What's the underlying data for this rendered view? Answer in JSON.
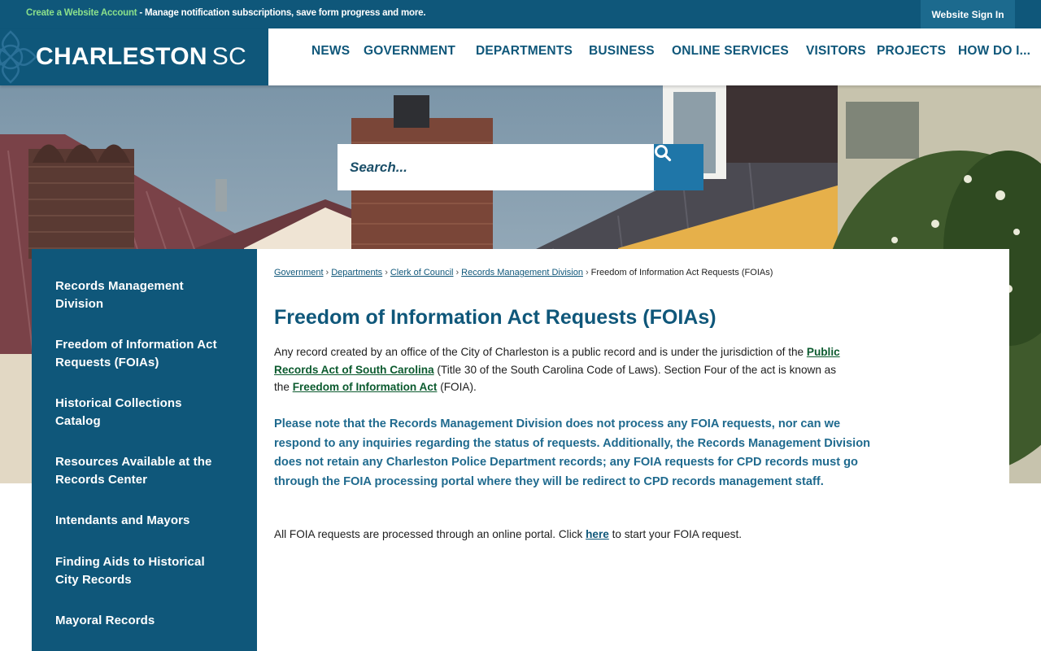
{
  "topbar": {
    "create_account_link": "Create a Website Account",
    "message": " - Manage notification subscriptions, save form progress and more.",
    "signin_label": "Website Sign In"
  },
  "logo": {
    "name": "CHARLESTON",
    "suffix": "SC"
  },
  "nav": {
    "items": [
      "NEWS",
      "GOVERNMENT",
      "DEPARTMENTS",
      "BUSINESS",
      "ONLINE SERVICES",
      "VISITORS",
      "PROJECTS",
      "HOW DO I..."
    ]
  },
  "search": {
    "placeholder": "Search...",
    "icon": "search-icon"
  },
  "sidebar": {
    "items": [
      "Records Management Division",
      "Freedom of Information Act Requests (FOIAs)",
      "Historical Collections Catalog",
      "Resources Available at the Records Center",
      "Intendants and Mayors",
      "Finding Aids to Historical City Records",
      "Mayoral Records"
    ]
  },
  "breadcrumb": {
    "items": [
      "Government",
      "Departments",
      "Clerk of Council",
      "Records Management Division"
    ],
    "separator": "›",
    "current": "Freedom of Information Act Requests (FOIAs)"
  },
  "page": {
    "title": "Freedom of Information Act Requests (FOIAs)",
    "intro_1": "Any record created by an office of the City of Charleston is a public record and is under the jurisdiction of the ",
    "intro_link_1": "Public Records Act of South Carolina",
    "intro_2": " (Title 30 of the South Carolina Code of Laws). Section Four of the act is known as the ",
    "intro_link_2": "Freedom of Information Act",
    "intro_3": "  (FOIA).",
    "notice": "Please note that the Records Management Division does not process any FOIA requests, nor can we respond to any inquiries regarding the status of requests. Additionally, the Records Management Division does not retain any Charleston Police Department records; any FOIA requests for CPD records must go through the FOIA processing portal where they will be redirect to CPD records management staff.",
    "portal_1": "All FOIA requests are processed through an online portal. Click ",
    "portal_link": "here",
    "portal_2": " to start your FOIA request."
  },
  "colors": {
    "brand": "#0f577a",
    "accent_button": "#1f76a8",
    "link_green": "#0c5b2f",
    "notice_blue": "#1f6a8e"
  }
}
